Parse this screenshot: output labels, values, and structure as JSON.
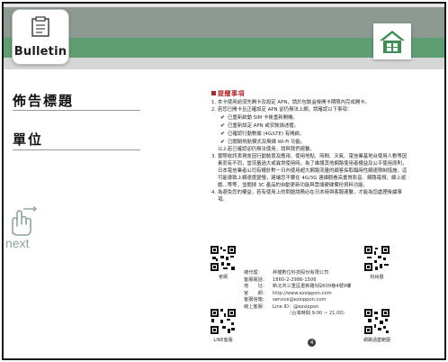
{
  "header": {
    "logo_text": "Bulletin",
    "logo_icon": "bulletin-board-icon",
    "home_icon": "home-icon",
    "colors": {
      "band_gray": "#8c9a92",
      "band_green": "#5f9e72",
      "home_green": "#3f8f55"
    }
  },
  "left": {
    "title": "佈告標題",
    "unit": "單位",
    "next_label": "next",
    "next_icon": "swipe-hand-icon"
  },
  "notice": {
    "title": "提醒事項",
    "items": [
      {
        "num": "1.",
        "text": "本卡使用前須先開卡及設定 APN，請於包裝盒後開卡期限內完成開卡。"
      },
      {
        "num": "2.",
        "text": "若您已開卡且正確設定 APN 卻仍無法上網，請確認以下事項："
      }
    ],
    "checks": [
      "已重新啟動 SIM 卡後重新開機。",
      "已重新設定 APN 或安裝描述檔。",
      "已確認行動數據 (4G/LTE) 有開啟。",
      "已關閉飛航模式及無線 Wi-Fi 功能。"
    ],
    "after_checks": "以上若已確認卻仍無法使用，請與我們連繫。",
    "items2": [
      {
        "num": "3.",
        "text": "實際收訊表現會因行動裝置及應用、使用地點、時間、天氣、電信業基地台使用人數等因素而有不同，當流量過大或異常使用時，為了維護其他網路使用者權益及公平使用原則，日本電信業者公司有權針對一日內使用超大網路流量的顧客採取臨時性網速限制措施，這可能導致上網速度變慢，建議您不要在 4G/3G 連線觀看高畫質影音、網路電視、線上遊戲…等等，並關掉 3C 產品的自動更新功能與雲端硬碟備份資料功能。"
      },
      {
        "num": "4.",
        "text": "為避免您的權益，若有使用上的問題請務必在日本時與客服連繫，才能為您處理後續事項。"
      }
    ]
  },
  "qr_labels": {
    "official": "官網",
    "fan_page": "粉絲團",
    "line": "LINE客服",
    "coverage": "網路涵蓋範圍"
  },
  "contact": [
    {
      "k": "總代理：",
      "v": "昇龍數位科技股份有限公司"
    },
    {
      "k": "客服電話：",
      "v": "1860-2-2986-1506"
    },
    {
      "k": "地　　址：",
      "v": "新北市三重區重新路5段609巷4號9樓"
    },
    {
      "k": "官　　網：",
      "v": "http://www.ezsippon.com"
    },
    {
      "k": "客服信箱：",
      "v": "service@ezsippon.com"
    },
    {
      "k": "線上客服：",
      "v": "Line ID：@ezsippon"
    },
    {
      "k": "",
      "v": "（台灣時間 9:00 ~ 21:00）"
    }
  ],
  "page_number": "4"
}
